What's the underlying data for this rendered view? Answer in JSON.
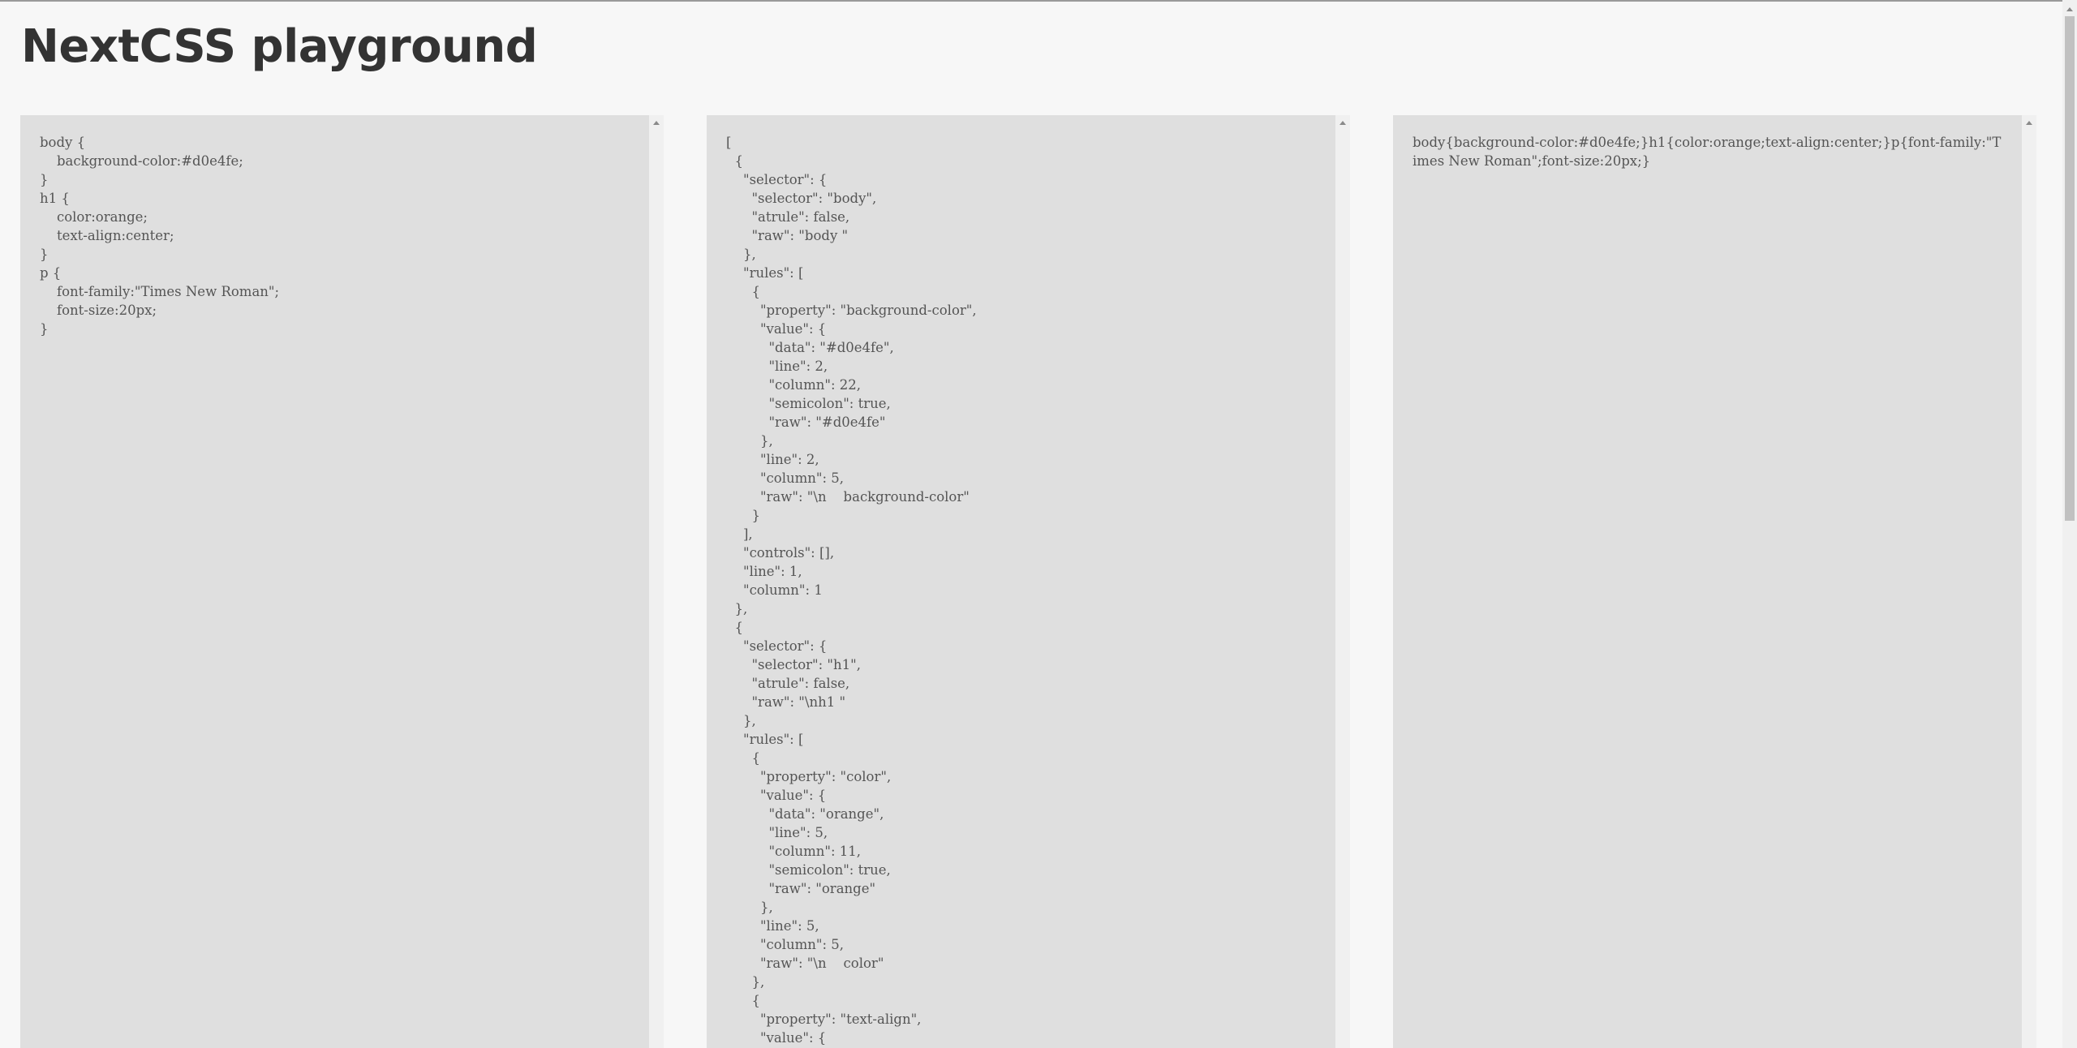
{
  "page": {
    "title": "NextCSS playground"
  },
  "panels": {
    "input": {
      "value": "body {\n    background-color:#d0e4fe;\n}\nh1 {\n    color:orange;\n    text-align:center;\n}\np {\n    font-family:\"Times New Roman\";\n    font-size:20px;\n}"
    },
    "ast": {
      "value": "[\n  {\n    \"selector\": {\n      \"selector\": \"body\",\n      \"atrule\": false,\n      \"raw\": \"body \"\n    },\n    \"rules\": [\n      {\n        \"property\": \"background-color\",\n        \"value\": {\n          \"data\": \"#d0e4fe\",\n          \"line\": 2,\n          \"column\": 22,\n          \"semicolon\": true,\n          \"raw\": \"#d0e4fe\"\n        },\n        \"line\": 2,\n        \"column\": 5,\n        \"raw\": \"\\n    background-color\"\n      }\n    ],\n    \"controls\": [],\n    \"line\": 1,\n    \"column\": 1\n  },\n  {\n    \"selector\": {\n      \"selector\": \"h1\",\n      \"atrule\": false,\n      \"raw\": \"\\nh1 \"\n    },\n    \"rules\": [\n      {\n        \"property\": \"color\",\n        \"value\": {\n          \"data\": \"orange\",\n          \"line\": 5,\n          \"column\": 11,\n          \"semicolon\": true,\n          \"raw\": \"orange\"\n        },\n        \"line\": 5,\n        \"column\": 5,\n        \"raw\": \"\\n    color\"\n      },\n      {\n        \"property\": \"text-align\",\n        \"value\": {"
    },
    "output": {
      "value": "body{background-color:#d0e4fe;}h1{color:orange;text-align:center;}p{font-family:\"Times New Roman\";font-size:20px;}"
    }
  },
  "colors": {
    "page_background": "#f7f7f7",
    "panel_background": "#dfdfdf",
    "text": "#555555",
    "title": "#333333"
  },
  "icons": {
    "scroll_up": "scroll-up-arrow-icon"
  }
}
